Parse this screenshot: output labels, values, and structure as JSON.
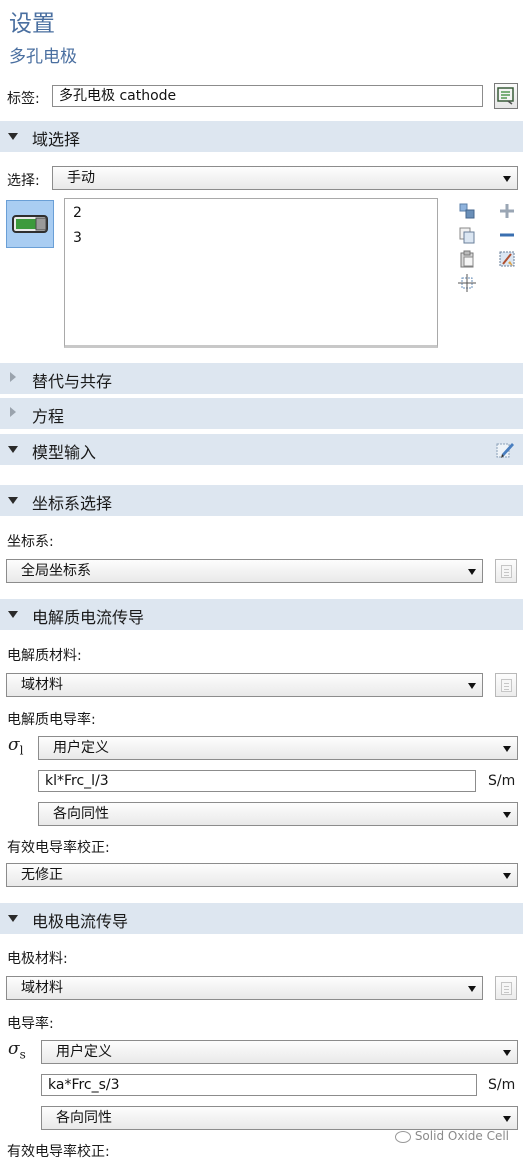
{
  "header": {
    "title": "设置",
    "subtitle": "多孔电极"
  },
  "label_row": {
    "label": "标签:",
    "value": "多孔电极 cathode",
    "button_icon": "edit-label-icon"
  },
  "domain_selection": {
    "section_title": "域选择",
    "select_label": "选择:",
    "select_value": "手动",
    "list_items": [
      "2",
      "3"
    ],
    "toolbar_icons": [
      "add-to-selection-icon",
      "remove-from-selection-icon",
      "copy-selection-icon",
      "paste-selection-icon",
      "zoom-to-selection-icon",
      "clear-selection-icon",
      "plus-icon",
      "minus-icon"
    ]
  },
  "collapsed_sections": [
    "替代与共存",
    "方程"
  ],
  "model_input": {
    "section_title": "模型输入",
    "icon": "model-input-edit-icon"
  },
  "coordinate_system": {
    "section_title": "坐标系选择",
    "field_label": "坐标系:",
    "value": "全局坐标系"
  },
  "electrolyte_current": {
    "section_title": "电解质电流传导",
    "material_label": "电解质材料:",
    "material_value": "域材料",
    "conductivity_label": "电解质电导率:",
    "symbol": "σ",
    "symbol_subscript": "l",
    "conductivity_mode": "用户定义",
    "expression": "kl*Frc_l/3",
    "unit": "S/m",
    "anisotropy": "各向同性",
    "correction_label": "有效电导率校正:",
    "correction_value": "无修正"
  },
  "electrode_current": {
    "section_title": "电极电流传导",
    "material_label": "电极材料:",
    "material_value": "域材料",
    "conductivity_label": "电导率:",
    "symbol": "σ",
    "symbol_subscript": "s",
    "conductivity_mode": "用户定义",
    "expression": "ka*Frc_s/3",
    "unit": "S/m",
    "anisotropy": "各向同性",
    "correction_label": "有效电导率校正:"
  },
  "watermark": "Solid Oxide Cell",
  "colors": {
    "title": "#4a6fa0",
    "section_bg": "#dde6f0",
    "accent_green": "#3c9a3c",
    "selected_button_bg": "#a9cdf2"
  }
}
